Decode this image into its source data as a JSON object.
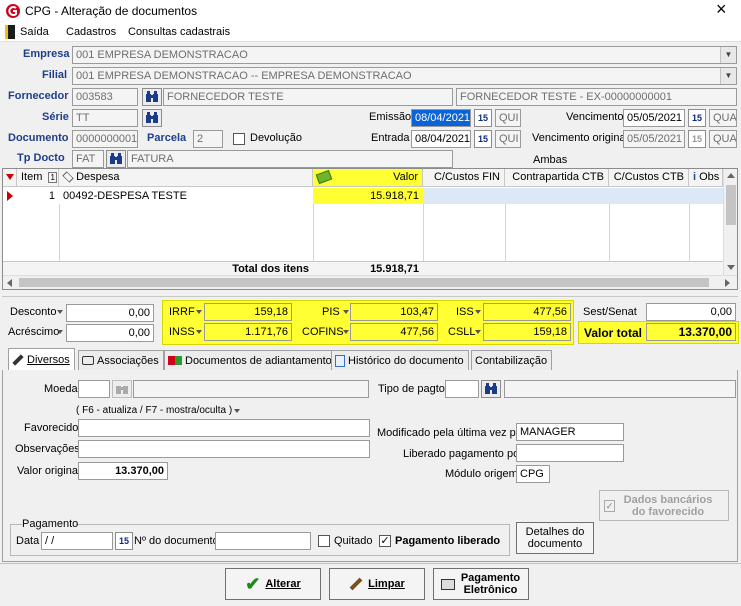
{
  "window": {
    "title": "CPG - Alteração de documentos",
    "close_glyph": "×"
  },
  "menu": {
    "items": [
      "Saída",
      "Cadastros",
      "Consultas cadastrais"
    ]
  },
  "header": {
    "empresa_label": "Empresa",
    "empresa_value": "001 EMPRESA DEMONSTRACAO",
    "filial_label": "Filial",
    "filial_value": "001 EMPRESA DEMONSTRACAO -- EMPRESA DEMONSTRACAO",
    "fornecedor_label": "Fornecedor",
    "fornecedor_code": "003583",
    "fornecedor_name": "FORNECEDOR TESTE",
    "fornecedor_desc": "FORNECEDOR TESTE - EX-00000000001",
    "serie_label": "Série",
    "serie_value": "TT",
    "emissao_label": "Emissão",
    "emissao_value": "08/04/2021",
    "emissao_day": "QUI",
    "vencimento_label": "Vencimento",
    "vencimento_value": "05/05/2021",
    "vencimento_day": "QUA",
    "documento_label": "Documento",
    "documento_value": "0000000001",
    "parcela_label": "Parcela",
    "parcela_value": "2",
    "devolucao_label": "Devolução",
    "entrada_label": "Entrada",
    "entrada_value": "08/04/2021",
    "entrada_day": "QUI",
    "venc_original_label": "Vencimento original",
    "venc_original_value": "05/05/2021",
    "venc_original_day": "QUA",
    "tpdocto_label": "Tp Docto",
    "tpdocto_code": "FAT",
    "tpdocto_name": "FATURA",
    "ambas_label": "Ambas",
    "cal_glyph": "15"
  },
  "grid": {
    "columns": [
      "Item",
      "Despesa",
      "Valor",
      "C/Custos FIN",
      "Contrapartida CTB",
      "C/Custos CTB",
      "Obs"
    ],
    "sort_badge": "1",
    "rows": [
      {
        "item": "1",
        "despesa": "00492-DESPESA TESTE",
        "valor": "15.918,71"
      }
    ],
    "total_label": "Total dos itens",
    "total_value": "15.918,71"
  },
  "taxes": {
    "desconto_label": "Desconto",
    "desconto_value": "0,00",
    "acrescimo_label": "Acréscimo",
    "acrescimo_value": "0,00",
    "irrf_label": "IRRF",
    "irrf_value": "159,18",
    "inss_label": "INSS",
    "inss_value": "1.171,76",
    "pis_label": "PIS",
    "pis_value": "103,47",
    "cofins_label": "COFINS",
    "cofins_value": "477,56",
    "iss_label": "ISS",
    "iss_value": "477,56",
    "csll_label": "CSLL",
    "csll_value": "159,18",
    "sestsenat_label": "Sest/Senat",
    "sestsenat_value": "0,00",
    "valortotal_label": "Valor total",
    "valortotal_value": "13.370,00"
  },
  "tabs": [
    "Diversos",
    "Associações",
    "Documentos de adiantamento",
    "Histórico do documento",
    "Contabilização"
  ],
  "diversos": {
    "moeda_label": "Moeda",
    "tipo_pagto_label": "Tipo de pagto",
    "hint": "( F6 - atualiza / F7 - mostra/oculta )",
    "favorecido_label": "Favorecido",
    "observacoes_label": "Observações",
    "valor_original_label": "Valor original",
    "valor_original_value": "13.370,00",
    "modificado_label": "Modificado pela última vez por",
    "modificado_value": "MANAGER",
    "liberado_label": "Liberado pagamento por",
    "modulo_label": "Módulo origem",
    "modulo_value": "CPG",
    "dados_bancarios_label": "Dados bancários do favorecido",
    "pagamento_group": "Pagamento",
    "data_label": "Data",
    "data_value": " / /",
    "ndoc_label": "Nº do documento",
    "quitado_label": "Quitado",
    "pag_liberado_label": "Pagamento liberado",
    "detalhes_label": "Detalhes do documento"
  },
  "buttons": {
    "alterar": "Alterar",
    "limpar": "Limpar",
    "pagamento": "Pagamento Eletrônico"
  },
  "colors": {
    "highlight": "#ffff33",
    "selection": "#0a64d8",
    "label_blue": "#1f3e8a",
    "logo_red": "#d0021b"
  }
}
